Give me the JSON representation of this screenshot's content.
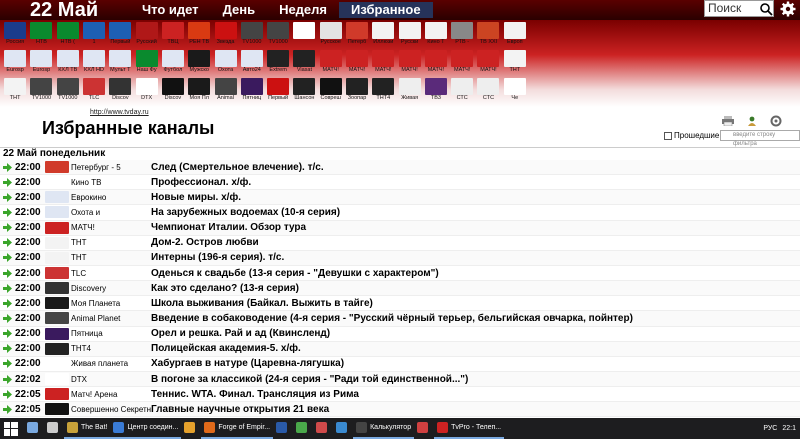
{
  "header": {
    "date_title": "22 Май",
    "nav": [
      "Что идет",
      "День",
      "Неделя",
      "Избранное"
    ],
    "active_nav_index": 3,
    "search_placeholder": "Поиск"
  },
  "channel_rows": [
    [
      {
        "name": "Россия",
        "color": "#1b3c8c"
      },
      {
        "name": "НТВ",
        "color": "#0a8a2e"
      },
      {
        "name": "НТВ (",
        "color": "#0a8a2e"
      },
      {
        "name": "1",
        "color": "#1d5fb4"
      },
      {
        "name": "Первый",
        "color": "#1d5fb4"
      },
      {
        "name": "Русский",
        "color": "#b01818"
      },
      {
        "name": "ТВЦ",
        "color": "#cc2222"
      },
      {
        "name": "РЕН ТВ",
        "color": "#d93a12"
      },
      {
        "name": "Звезда",
        "color": "#cc1111"
      },
      {
        "name": "TV1000",
        "color": "#444"
      },
      {
        "name": "TV1000",
        "color": "#444"
      },
      {
        "name": "",
        "color": "#fff"
      },
      {
        "name": "Русское",
        "color": "#e3e3e3"
      },
      {
        "name": "Петерб",
        "color": "#d03a2a"
      },
      {
        "name": "Иллюзи",
        "color": "#f3f3f3"
      },
      {
        "name": "Русски",
        "color": "#f3f3f3"
      },
      {
        "name": "Кино Т",
        "color": "#f3f3f3"
      },
      {
        "name": "РТВ -",
        "color": "#888"
      },
      {
        "name": "ТВ XXI",
        "color": "#c42"
      },
      {
        "name": "Европ",
        "color": "#f3f3f3"
      }
    ],
    [
      {
        "name": "Eurosp",
        "color": "#dfe6f3"
      },
      {
        "name": "Eurosp",
        "color": "#dfe6f3"
      },
      {
        "name": "КХЛ ТВ",
        "color": "#dfe6f3"
      },
      {
        "name": "КХЛ HD",
        "color": "#dfe6f3"
      },
      {
        "name": "Мульт Т",
        "color": "#dfe6f3"
      },
      {
        "name": "Наш Фу",
        "color": "#0a8a2e"
      },
      {
        "name": "Футбол",
        "color": "#dfe6f3"
      },
      {
        "name": "Мужско",
        "color": "#1a1a1a"
      },
      {
        "name": "Охота",
        "color": "#dfe6f3"
      },
      {
        "name": "Авто24",
        "color": "#dfe6f3"
      },
      {
        "name": "Extrem",
        "color": "#222"
      },
      {
        "name": "Viasat",
        "color": "#222"
      },
      {
        "name": "МАТЧ!",
        "color": "#cc2222"
      },
      {
        "name": "МАТЧ!",
        "color": "#cc2222"
      },
      {
        "name": "МАТЧ!",
        "color": "#cc2222"
      },
      {
        "name": "МАТЧ!",
        "color": "#cc2222"
      },
      {
        "name": "МАТЧ!",
        "color": "#cc2222"
      },
      {
        "name": "МАТЧ!",
        "color": "#cc2222"
      },
      {
        "name": "МАТЧ!",
        "color": "#cc2222"
      },
      {
        "name": "ТНТ",
        "color": "#f3f3f3"
      }
    ],
    [
      {
        "name": "ТНТ",
        "color": "#f3f3f3"
      },
      {
        "name": "TV1000",
        "color": "#444"
      },
      {
        "name": "TV1000",
        "color": "#444"
      },
      {
        "name": "TLC",
        "color": "#cc3333"
      },
      {
        "name": "Discov",
        "color": "#333"
      },
      {
        "name": "DTX",
        "color": "#fff"
      },
      {
        "name": "Discov",
        "color": "#111"
      },
      {
        "name": "Моя Пл",
        "color": "#1a1a1a"
      },
      {
        "name": "Animal",
        "color": "#444"
      },
      {
        "name": "Пятниц",
        "color": "#3a1a5e"
      },
      {
        "name": "Первый",
        "color": "#cc1111"
      },
      {
        "name": "Шансон",
        "color": "#222"
      },
      {
        "name": "Совреш",
        "color": "#111"
      },
      {
        "name": "Зоопар",
        "color": "#222"
      },
      {
        "name": "ТНТ4",
        "color": "#222"
      },
      {
        "name": "Живая",
        "color": "#eee"
      },
      {
        "name": "ТВ3",
        "color": "#5a2a7a"
      },
      {
        "name": "СТС",
        "color": "#eee"
      },
      {
        "name": "СТС",
        "color": "#eee"
      },
      {
        "name": "Че",
        "color": "#fff"
      }
    ]
  ],
  "url": "http://www.tvday.ru",
  "page_title": "Избранные каналы",
  "past_label": "Прошедшие",
  "filter_placeholder": "введите строку фильтра",
  "day_header": "22 Май понедельник",
  "schedule": [
    {
      "time": "22:00",
      "channel": "Петербург - 5",
      "logo": "#d03a2a",
      "show": "След (Смертельное влечение). т/с."
    },
    {
      "time": "22:00",
      "channel": "Кино ТВ",
      "logo": "#fff",
      "show": "Профессионал. х/ф."
    },
    {
      "time": "22:00",
      "channel": "Еврокино",
      "logo": "#dfe6f3",
      "show": "Новые миры. х/ф."
    },
    {
      "time": "22:00",
      "channel": "Охота и",
      "logo": "#dfe6f3",
      "show": "На зарубежных водоемах (10-я серия)"
    },
    {
      "time": "22:00",
      "channel": "МАТЧ!",
      "logo": "#cc2222",
      "show": "Чемпионат Италии. Обзор тура"
    },
    {
      "time": "22:00",
      "channel": "ТНТ",
      "logo": "#f3f3f3",
      "show": "Дом-2. Остров любви"
    },
    {
      "time": "22:00",
      "channel": "ТНТ",
      "logo": "#f3f3f3",
      "show": "Интерны (196-я серия). т/с."
    },
    {
      "time": "22:00",
      "channel": "TLC",
      "logo": "#cc3333",
      "show": "Оденься к свадьбе (13-я серия - \"Девушки с характером\")"
    },
    {
      "time": "22:00",
      "channel": "Discovery",
      "logo": "#333",
      "show": "Как это сделано? (13-я серия)"
    },
    {
      "time": "22:00",
      "channel": "Моя Планета",
      "logo": "#1a1a1a",
      "show": "Школа выживания (Байкал. Выжить в тайге)"
    },
    {
      "time": "22:00",
      "channel": "Animal Planet",
      "logo": "#444",
      "show": "Введение в собаководение (4-я серия - \"Русский чёрный терьер, бельгийская овчарка, пойнтер)"
    },
    {
      "time": "22:00",
      "channel": "Пятница",
      "logo": "#3a1a5e",
      "show": "Орел и решка. Рай и ад (Квинсленд)"
    },
    {
      "time": "22:00",
      "channel": "ТНТ4",
      "logo": "#222",
      "show": "Полицейская академия-5. х/ф."
    },
    {
      "time": "22:00",
      "channel": "Живая планета",
      "logo": "#fff",
      "show": "Хабургаев в натуре (Царевна-лягушка)"
    },
    {
      "time": "22:02",
      "channel": "DTX",
      "logo": "#fff",
      "show": "В погоне за классикой (24-я серия - \"Ради той единственной...\")"
    },
    {
      "time": "22:05",
      "channel": "Матч! Арена",
      "logo": "#cc2222",
      "show": "Теннис. WTA. Финал. Трансляция из Рима"
    },
    {
      "time": "22:05",
      "channel": "Совершенно Секретно",
      "logo": "#111",
      "show": "Главные научные открытия 21 века"
    }
  ],
  "taskbar": {
    "items": [
      {
        "label": "",
        "color": "#7aa9e0"
      },
      {
        "label": "",
        "color": "#ccc"
      },
      {
        "label": "The Bat!",
        "color": "#c8a23a"
      },
      {
        "label": "Центр соедин...",
        "color": "#3a7bd5"
      },
      {
        "label": "",
        "color": "#e5a12c"
      },
      {
        "label": "Forge of Empir...",
        "color": "#e06a1a"
      },
      {
        "label": "",
        "color": "#2a5aa8"
      },
      {
        "label": "",
        "color": "#4aa84a"
      },
      {
        "label": "",
        "color": "#d04a4a"
      },
      {
        "label": "",
        "color": "#3a8ad0"
      },
      {
        "label": "Калькулятор",
        "color": "#444"
      },
      {
        "label": "",
        "color": "#d04040"
      },
      {
        "label": "TvPro - Телеп...",
        "color": "#cc2222"
      }
    ],
    "lang": "РУС",
    "clock": "22:1"
  }
}
